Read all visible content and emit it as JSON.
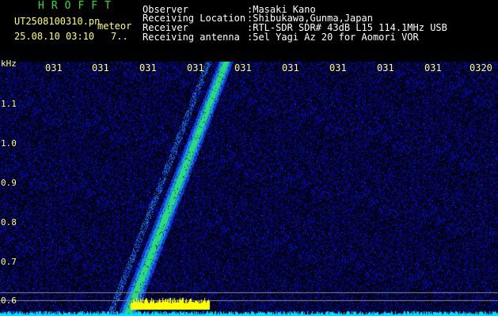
{
  "header": {
    "brand": "HROFFT",
    "filename": "UT2508100310.pn",
    "tag": "meteor",
    "timestamp": "25.08.10 03:10",
    "count": "7..",
    "labels": {
      "observer": "Observer",
      "location": "Receiving Location",
      "receiver": "Receiver",
      "antenna": "Receiving antenna"
    },
    "values": {
      "observer": ":Masaki Kano",
      "location": ":Shibukawa,Gunma,Japan",
      "receiver": ":RTL-SDR SDR# 43dB L15 114.1MHz USB",
      "antenna": ":5el Yagi Az 20 for Aomori VOR"
    }
  },
  "axes": {
    "y_unit": "kHz",
    "y_ticks": [
      "1.1",
      "1.0",
      "0.9",
      "0.8",
      "0.7",
      "0.6"
    ],
    "x_ticks": [
      "031",
      "031",
      "031",
      "031",
      "031",
      "031",
      "031",
      "031",
      "031",
      "0320"
    ]
  },
  "colors": {
    "background": "#000000",
    "noise": "#0a1a9a",
    "signal": "#00e060",
    "burst": "#ffff00",
    "baseline": "#00e0ff",
    "tick_text": "#ffff66",
    "header_brand": "#33dd33"
  }
}
